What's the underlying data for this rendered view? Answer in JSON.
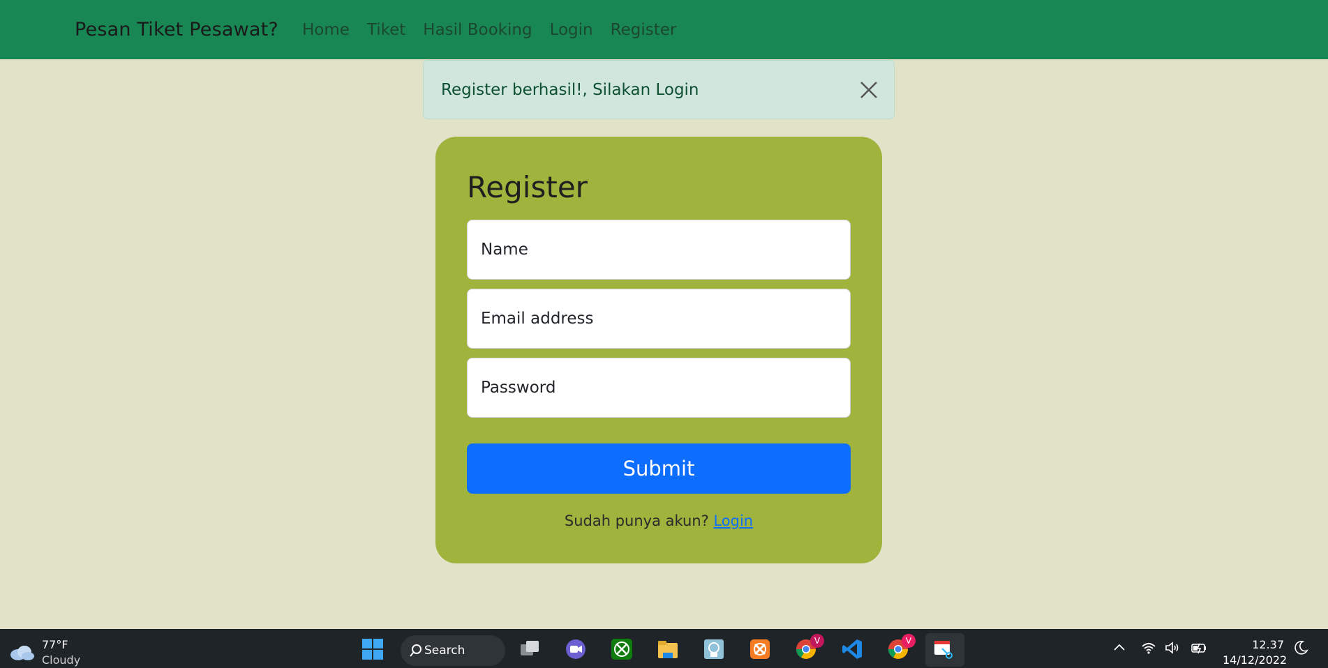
{
  "navbar": {
    "brand": "Pesan Tiket Pesawat?",
    "links": [
      "Home",
      "Tiket",
      "Hasil Booking",
      "Login",
      "Register"
    ]
  },
  "alert": {
    "message": "Register berhasil!, Silakan Login"
  },
  "form": {
    "title": "Register",
    "name_placeholder": "Name",
    "email_placeholder": "Email address",
    "password_placeholder": "Password",
    "submit_label": "Submit",
    "footer_text": "Sudah punya akun?",
    "footer_link": "Login"
  },
  "taskbar": {
    "weather_temp": "77°F",
    "weather_condition": "Cloudy",
    "search_label": "Search",
    "time": "12.37",
    "date": "14/12/2022",
    "badge_letter": "V",
    "icons": [
      "windows-start-icon",
      "task-view-icon",
      "teams-chat-icon",
      "xbox-icon",
      "file-explorer-icon",
      "photos-icon",
      "xampp-icon",
      "chrome-icon",
      "vscode-icon",
      "chrome-icon",
      "snipping-tool-icon"
    ]
  },
  "colors": {
    "navbar": "#198754",
    "page_background": "#e2e2c9",
    "card": "#a0b33d",
    "alert_background": "#d1e7dd",
    "submit": "#0d6efd"
  }
}
